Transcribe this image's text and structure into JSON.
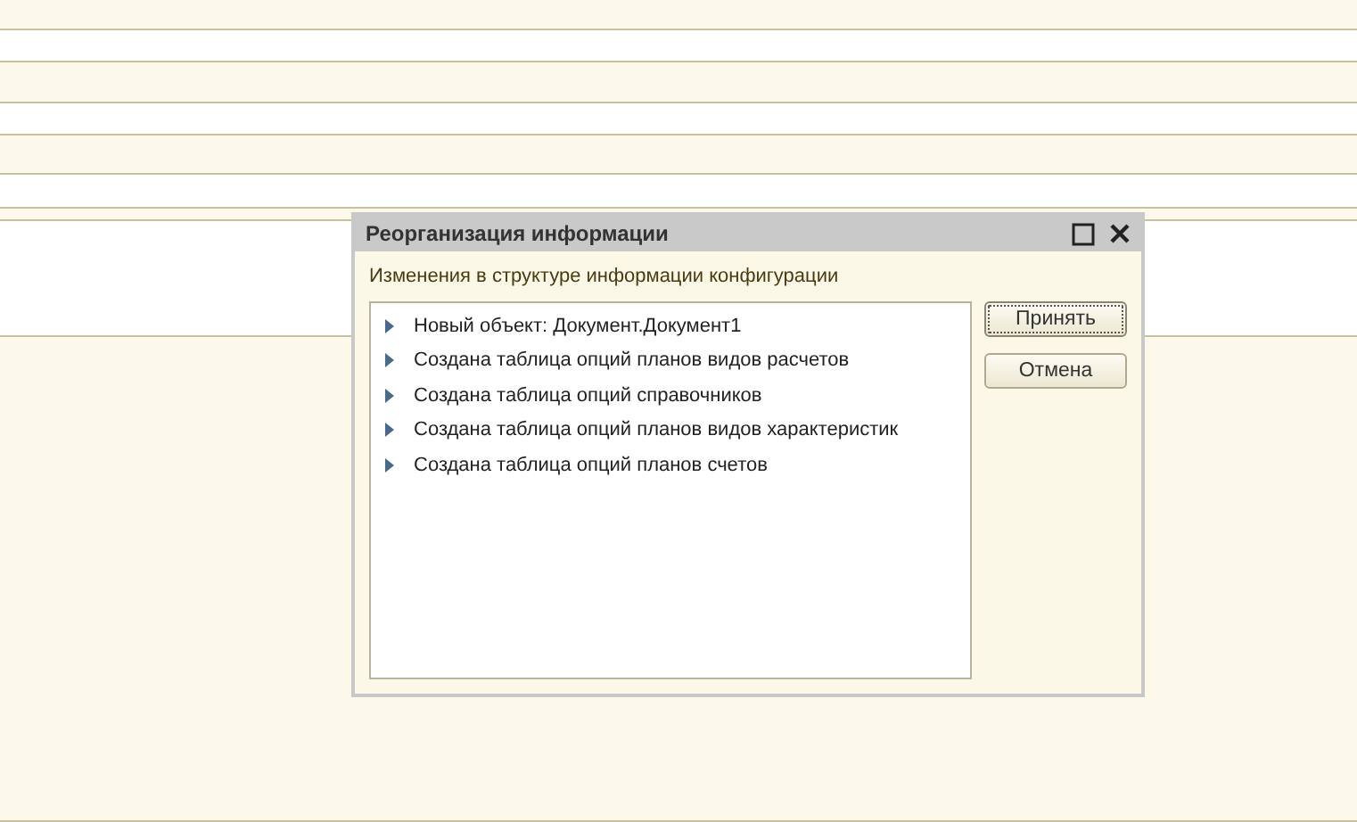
{
  "dialog": {
    "title": "Реорганизация информации",
    "caption": "Изменения в структуре информации конфигурации",
    "items": [
      {
        "text": "Новый объект: Документ.Документ1",
        "expanded": false
      },
      {
        "text": "Создана таблица опций планов видов расчетов",
        "expanded": false
      },
      {
        "text": "Создана таблица опций справочников",
        "expanded": false
      },
      {
        "text": "Создана таблица опций планов видов характеристик",
        "expanded": false
      },
      {
        "text": "Создана таблица опций планов счетов",
        "expanded": false
      }
    ],
    "buttons": [
      {
        "label": "Принять",
        "default": true
      },
      {
        "label": "Отмена",
        "default": false
      }
    ]
  }
}
